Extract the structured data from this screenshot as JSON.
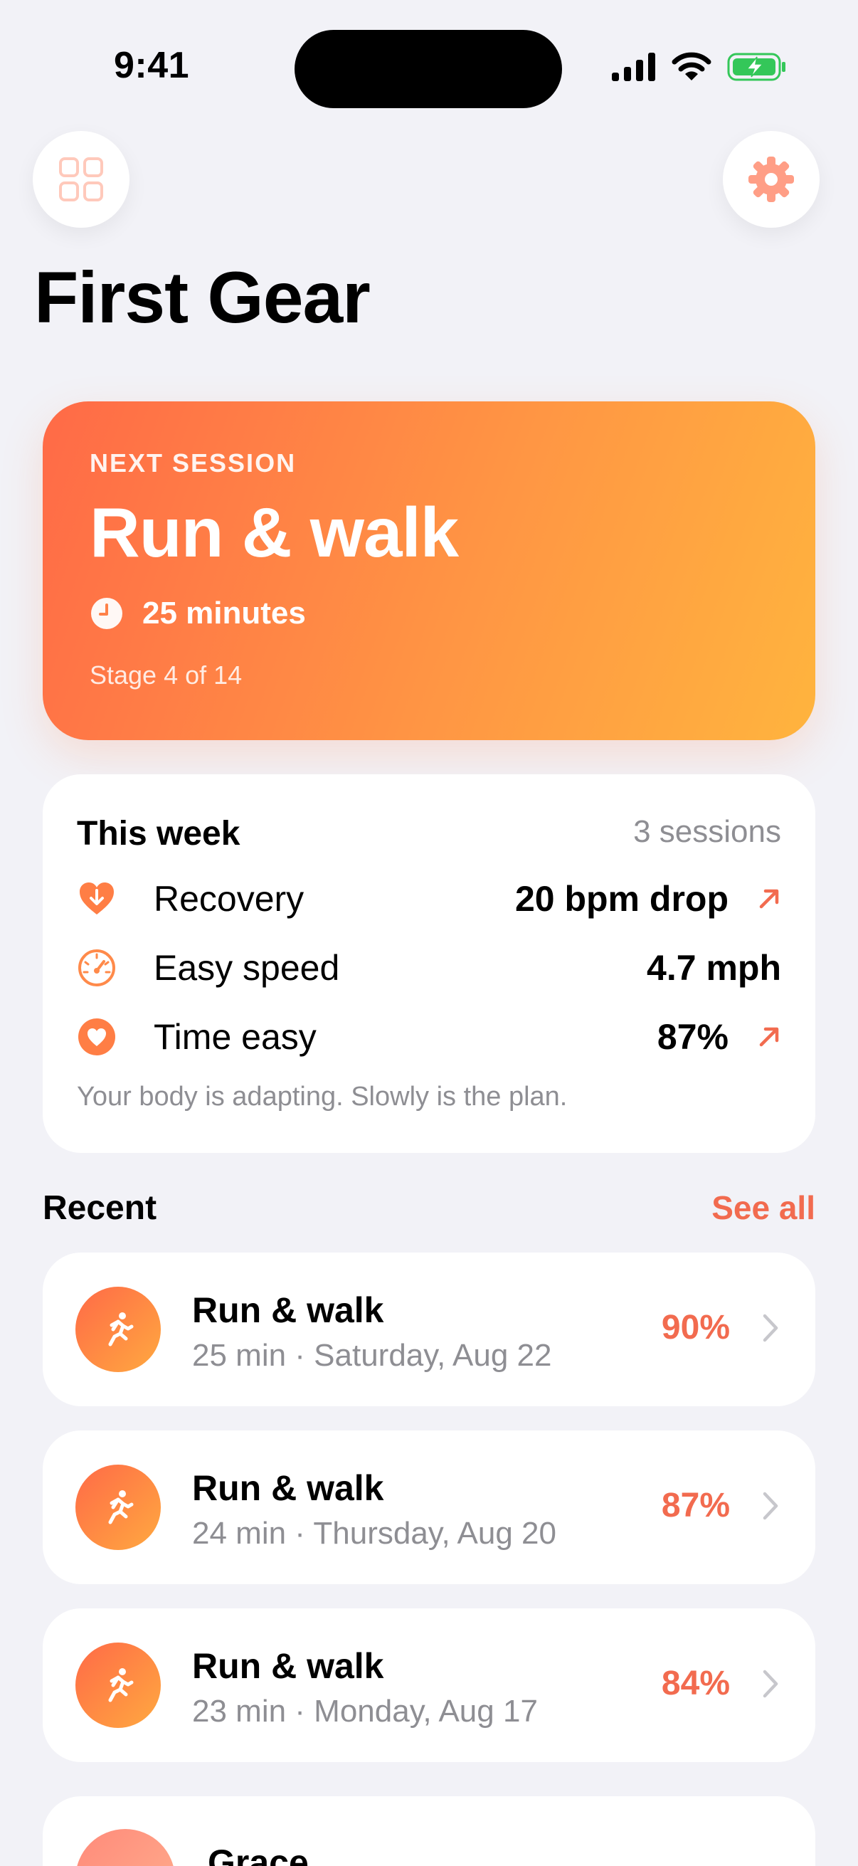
{
  "status_bar": {
    "time": "9:41"
  },
  "header": {
    "title": "First Gear"
  },
  "next_session": {
    "label": "NEXT SESSION",
    "title": "Run & walk",
    "duration": "25 minutes",
    "stage": "Stage 4 of 14"
  },
  "this_week": {
    "title": "This week",
    "count": "3 sessions",
    "stats": [
      {
        "icon": "heart-down-icon",
        "label": "Recovery",
        "value": "20 bpm drop",
        "trend": "up-right-arrow-icon"
      },
      {
        "icon": "speedometer-icon",
        "label": "Easy speed",
        "value": "4.7 mph",
        "trend": ""
      },
      {
        "icon": "heart-icon",
        "label": "Time easy",
        "value": "87%",
        "trend": "up-right-arrow-icon"
      }
    ],
    "note": "Your body is adapting. Slowly is the plan."
  },
  "recent": {
    "title": "Recent",
    "see_all": "See all",
    "items": [
      {
        "title": "Run & walk",
        "meta": "25 min · Saturday, Aug 22",
        "percent": "90%"
      },
      {
        "title": "Run & walk",
        "meta": "24 min · Thursday, Aug 20",
        "percent": "87%"
      },
      {
        "title": "Run & walk",
        "meta": "23 min · Monday, Aug 17",
        "percent": "84%"
      }
    ]
  },
  "coach": {
    "name": "Grace"
  },
  "colors": {
    "accent": "#F26B4F",
    "hero_start": "#FF6A47",
    "hero_end": "#FFB43E",
    "secondary_text": "#8E8E93",
    "background": "#F2F2F7"
  }
}
